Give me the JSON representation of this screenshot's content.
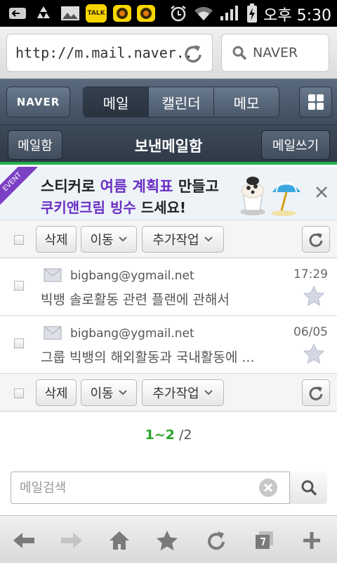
{
  "status_bar": {
    "time": "오후 5:30",
    "icons": [
      "usb-debug-icon",
      "recycle-icon",
      "gallery-icon",
      "kakaotalk-icon",
      "ka-icon",
      "ka-icon",
      "alarm-icon",
      "wifi-icon",
      "signal-icon",
      "battery-charging-icon"
    ],
    "kakao_label": "TALK"
  },
  "browser": {
    "url": "http://m.mail.naver..",
    "search_placeholder": "NAVER"
  },
  "nav": {
    "logo": "NAVER",
    "tabs": [
      {
        "label": "메일"
      },
      {
        "label": "캘린더"
      },
      {
        "label": "메모"
      }
    ]
  },
  "subheader": {
    "left_button": "메일함",
    "title": "보낸메일함",
    "right_button": "메일쓰기"
  },
  "banner": {
    "ribbon": "EVENT",
    "line1_a": "스티커로 ",
    "line1_b": "여름 계획표",
    "line1_c": " 만들고",
    "line2_a": "쿠키앤크림 빙수",
    "line2_b": " 드세요!"
  },
  "toolbar": {
    "delete": "삭제",
    "move": "이동",
    "more": "추가작업"
  },
  "mails": [
    {
      "from": "bigbang@ygmail.net",
      "subject": "빅뱅 솔로활동 관련 플랜에 관해서",
      "date": "17:29"
    },
    {
      "from": "bigbang@ygmail.net",
      "subject": "그룹 빅뱅의 해외활동과 국내활동에 ...",
      "date": "06/05"
    }
  ],
  "pagination": {
    "current": "1~2",
    "total": "/2"
  },
  "mail_search": {
    "placeholder": "메일검색"
  },
  "colors": {
    "accent_green": "#22b14c",
    "nav_dark": "#3e4c5d",
    "purple": "#6a2fc4"
  }
}
